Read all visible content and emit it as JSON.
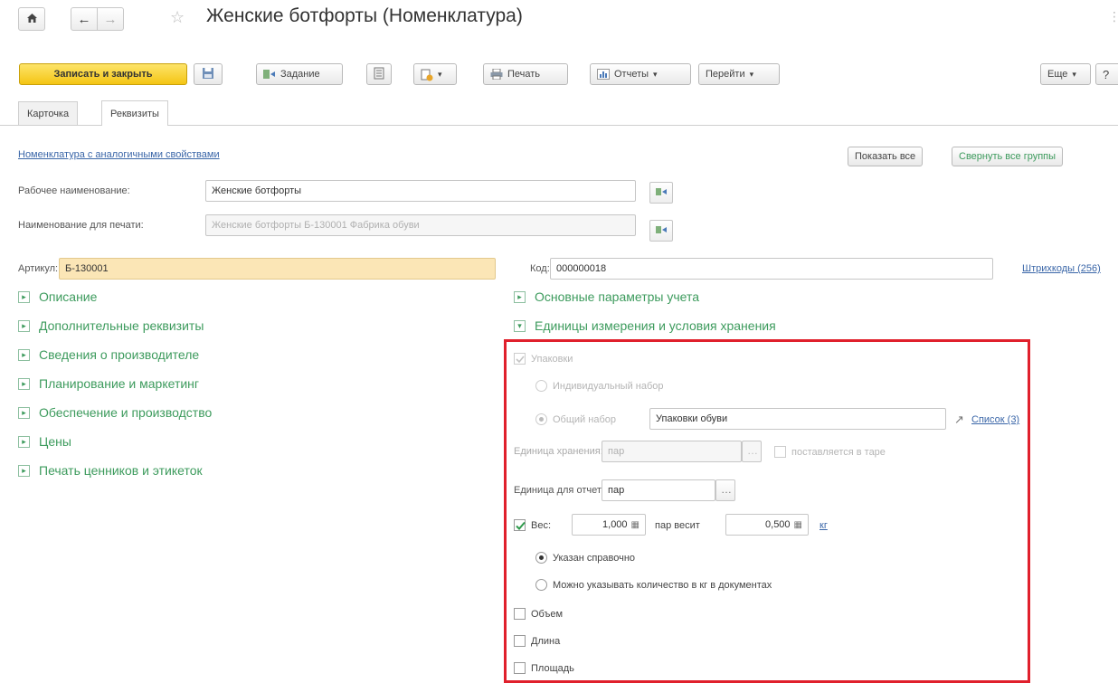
{
  "window": {
    "title": "Женские ботфорты (Номенклатура)",
    "corner_mark": "⋮"
  },
  "toolbar": {
    "save_close": "Записать и закрыть",
    "task": "Задание",
    "print": "Печать",
    "reports": "Отчеты",
    "goto": "Перейти",
    "more": "Еще",
    "help": "?"
  },
  "tabs": [
    {
      "label": "Карточка"
    },
    {
      "label": "Реквизиты"
    }
  ],
  "header": {
    "similar_link": "Номенклатура с аналогичными свойствами",
    "show_all": "Показать все",
    "collapse_all": "Свернуть все группы"
  },
  "form": {
    "work_name_label": "Рабочее наименование:",
    "work_name_value": "Женские ботфорты",
    "print_name_label": "Наименование для печати:",
    "print_name_value": "Женские ботфорты Б-130001 Фабрика обуви",
    "article_label": "Артикул:",
    "article_value": "Б-130001",
    "code_label": "Код:",
    "code_value": "000000018",
    "barcodes_link": "Штрихкоды (256)"
  },
  "groups_left": [
    "Описание",
    "Дополнительные реквизиты",
    "Сведения о производителе",
    "Планирование и маркетинг",
    "Обеспечение и производство",
    "Цены",
    "Печать ценников и этикеток"
  ],
  "groups_right": {
    "main_params": "Основные параметры учета",
    "units": "Единицы измерения и условия хранения"
  },
  "units_panel": {
    "packages_label": "Упаковки",
    "individual_set": "Индивидуальный набор",
    "common_set": "Общий набор",
    "common_set_value": "Упаковки обуви",
    "list_link": "Список (3)",
    "storage_unit_label": "Единица хранения:",
    "storage_unit_value": "пар",
    "in_container": "поставляется в таре",
    "report_unit_label": "Единица для отчетов:",
    "report_unit_value": "пар",
    "weight_label": "Вес:",
    "weight_qty": "1,000",
    "weight_text": "пар весит",
    "weight_value": "0,500",
    "weight_unit": "кг",
    "radio_reference": "Указан справочно",
    "radio_docs": "Можно указывать количество в кг в документах",
    "volume": "Объем",
    "length": "Длина",
    "area": "Площадь"
  }
}
